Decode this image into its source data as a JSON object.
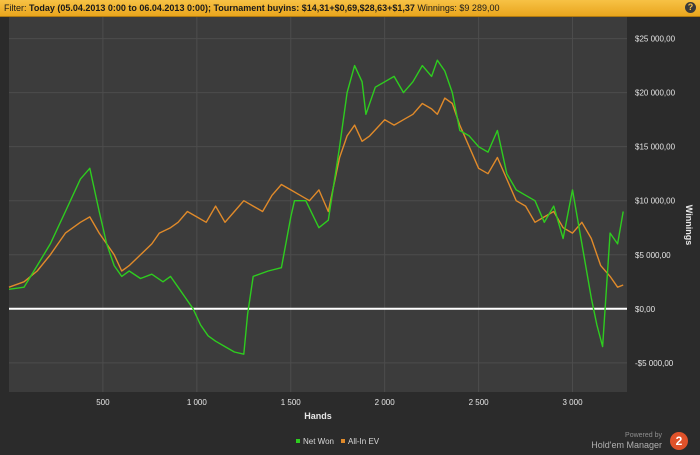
{
  "filter_bar": {
    "label": "Filter: ",
    "text": "Today (05.04.2013 0:00 to 06.04.2013 0:00); Tournament buyins: $14,31+$0,69,$28,63+$1,37",
    "winnings": " Winnings: $9 289,00",
    "help_icon": "?"
  },
  "watermark": {
    "powered_by": "Powered by",
    "product": "Hold'em Manager",
    "logo_text": "2"
  },
  "chart_data": {
    "type": "line",
    "xlabel": "Hands",
    "ylabel": "Winnings",
    "xlim": [
      0,
      3290
    ],
    "ylim": [
      -7700,
      27000
    ],
    "x_ticks": [
      500,
      1000,
      1500,
      2000,
      2500,
      3000
    ],
    "x_tick_labels": [
      "500",
      "1 000",
      "1 500",
      "2 000",
      "2 500",
      "3 000"
    ],
    "y_ticks": [
      -5000,
      0,
      5000,
      10000,
      15000,
      20000,
      25000
    ],
    "y_tick_labels": [
      "-$5 000,00",
      "$0,00",
      "$5 000,00",
      "$10 000,00",
      "$15 000,00",
      "$20 000,00",
      "$25 000,00"
    ],
    "grid": true,
    "zero_line": true,
    "legend_position": "bottom-center",
    "series": [
      {
        "name": "Net Won",
        "color": "#2ecc1f",
        "x": [
          0,
          80,
          150,
          220,
          300,
          380,
          430,
          480,
          520,
          560,
          600,
          640,
          700,
          760,
          820,
          860,
          900,
          940,
          980,
          1020,
          1060,
          1100,
          1150,
          1200,
          1250,
          1270,
          1300,
          1380,
          1450,
          1500,
          1520,
          1580,
          1650,
          1700,
          1760,
          1800,
          1840,
          1880,
          1900,
          1950,
          2000,
          2050,
          2100,
          2150,
          2200,
          2250,
          2280,
          2320,
          2360,
          2400,
          2450,
          2500,
          2550,
          2600,
          2650,
          2700,
          2750,
          2800,
          2850,
          2900,
          2950,
          3000,
          3050,
          3100,
          3130,
          3160,
          3200,
          3240,
          3270
        ],
        "y": [
          1800,
          2000,
          4000,
          6000,
          9000,
          12000,
          13000,
          9000,
          6000,
          4000,
          3000,
          3500,
          2800,
          3200,
          2500,
          3000,
          2000,
          1000,
          0,
          -1500,
          -2500,
          -3000,
          -3500,
          -4000,
          -4200,
          -500,
          3000,
          3500,
          3800,
          8500,
          10000,
          10000,
          7500,
          8200,
          15000,
          20000,
          22500,
          21000,
          18000,
          20500,
          21000,
          21500,
          20000,
          21000,
          22500,
          21500,
          23000,
          22000,
          20000,
          16500,
          16000,
          15000,
          14500,
          16500,
          12500,
          11000,
          10500,
          10000,
          8000,
          9500,
          6500,
          11000,
          6000,
          1000,
          -1500,
          -3500,
          7000,
          6000,
          9000
        ]
      },
      {
        "name": "All-In EV",
        "color": "#e08a2a",
        "x": [
          0,
          80,
          150,
          220,
          300,
          380,
          430,
          480,
          520,
          560,
          600,
          640,
          700,
          760,
          800,
          860,
          900,
          950,
          1000,
          1050,
          1100,
          1150,
          1200,
          1250,
          1300,
          1350,
          1400,
          1450,
          1500,
          1550,
          1600,
          1650,
          1700,
          1760,
          1800,
          1840,
          1880,
          1920,
          2000,
          2050,
          2100,
          2150,
          2200,
          2250,
          2280,
          2320,
          2360,
          2400,
          2450,
          2500,
          2550,
          2600,
          2650,
          2700,
          2750,
          2800,
          2850,
          2900,
          2950,
          3000,
          3050,
          3100,
          3150,
          3200,
          3240,
          3270
        ],
        "y": [
          2000,
          2500,
          3500,
          5000,
          7000,
          8000,
          8500,
          7000,
          6000,
          5000,
          3500,
          4000,
          5000,
          6000,
          7000,
          7500,
          8000,
          9000,
          8500,
          8000,
          9500,
          8000,
          9000,
          10000,
          9500,
          9000,
          10500,
          11500,
          11000,
          10500,
          10000,
          11000,
          9000,
          14000,
          16000,
          17000,
          15500,
          16000,
          17500,
          17000,
          17500,
          18000,
          19000,
          18500,
          18000,
          19500,
          19000,
          17000,
          15000,
          13000,
          12500,
          14000,
          12000,
          10000,
          9500,
          8000,
          8500,
          9000,
          7500,
          7000,
          8000,
          6500,
          4000,
          3000,
          2000,
          2200
        ]
      }
    ]
  }
}
